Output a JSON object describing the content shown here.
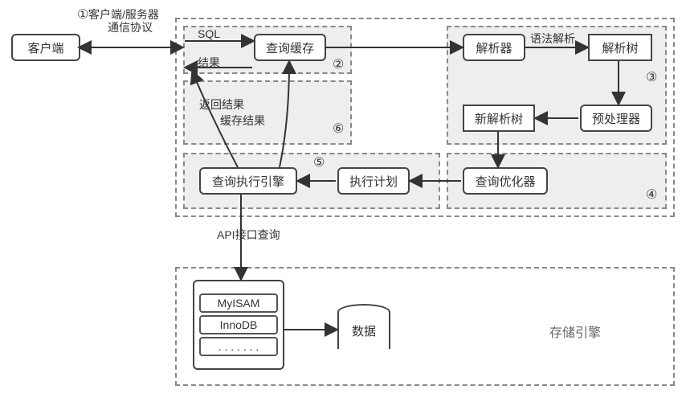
{
  "nodes": {
    "client": "客户端",
    "query_cache": "查询缓存",
    "parser": "解析器",
    "parse_tree": "解析树",
    "new_parse_tree": "新解析树",
    "preprocessor": "预处理器",
    "optimizer": "查询优化器",
    "exec_plan": "执行计划",
    "exec_engine": "查询执行引擎",
    "storage_engines": [
      "MyISAM",
      "InnoDB",
      ". . . . . . ."
    ],
    "data": "数据",
    "storage_section_label": "存储引擎"
  },
  "edge_labels": {
    "client_server_protocol_line1": "客户端/服务器",
    "client_server_protocol_line2": "通信协议",
    "sql": "SQL",
    "result": "结果",
    "syntax_parse": "语法解析",
    "return_result": "返回结果",
    "cache_result": "缓存结果",
    "api_query": "API接口查询"
  },
  "step_markers": {
    "s1": "①",
    "s2": "②",
    "s3": "③",
    "s4": "④",
    "s5": "⑤",
    "s6": "⑥"
  }
}
